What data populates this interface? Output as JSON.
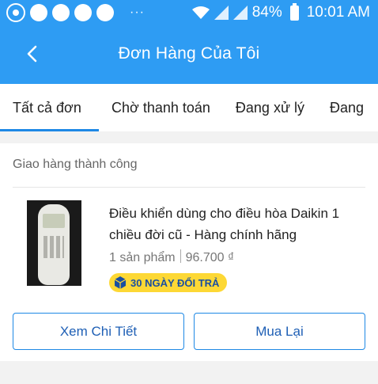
{
  "status_bar": {
    "dots": "···",
    "battery_percent": "84%",
    "time": "10:01 AM",
    "icons": [
      "viber-icon",
      "notification-icon",
      "notification-icon",
      "notification-icon",
      "notification-icon",
      "wifi-icon",
      "signal-icon",
      "signal-icon",
      "battery-icon"
    ]
  },
  "header": {
    "title": "Đơn Hàng Của Tôi",
    "back_icon": "chevron-left-icon"
  },
  "tabs": [
    {
      "label": "Tất cả đơn",
      "active": true
    },
    {
      "label": "Chờ thanh toán",
      "active": false
    },
    {
      "label": "Đang xử lý",
      "active": false
    },
    {
      "label": "Đang",
      "active": false
    }
  ],
  "order": {
    "status": "Giao hàng thành công",
    "product_name": "Điều khiển dùng cho điều hòa Daikin 1 chiều đời cũ - Hàng chính hãng",
    "quantity": "1 sản phẩm",
    "price": "96.700 ₫",
    "badge": "30 NGÀY ĐỔI TRẢ",
    "detail_button": "Xem Chi Tiết",
    "rebuy_button": "Mua Lại"
  },
  "colors": {
    "primary": "#2e9cf3",
    "accent": "#1e88e5",
    "badge_bg": "#fdd835",
    "badge_text": "#1a4fa0"
  }
}
